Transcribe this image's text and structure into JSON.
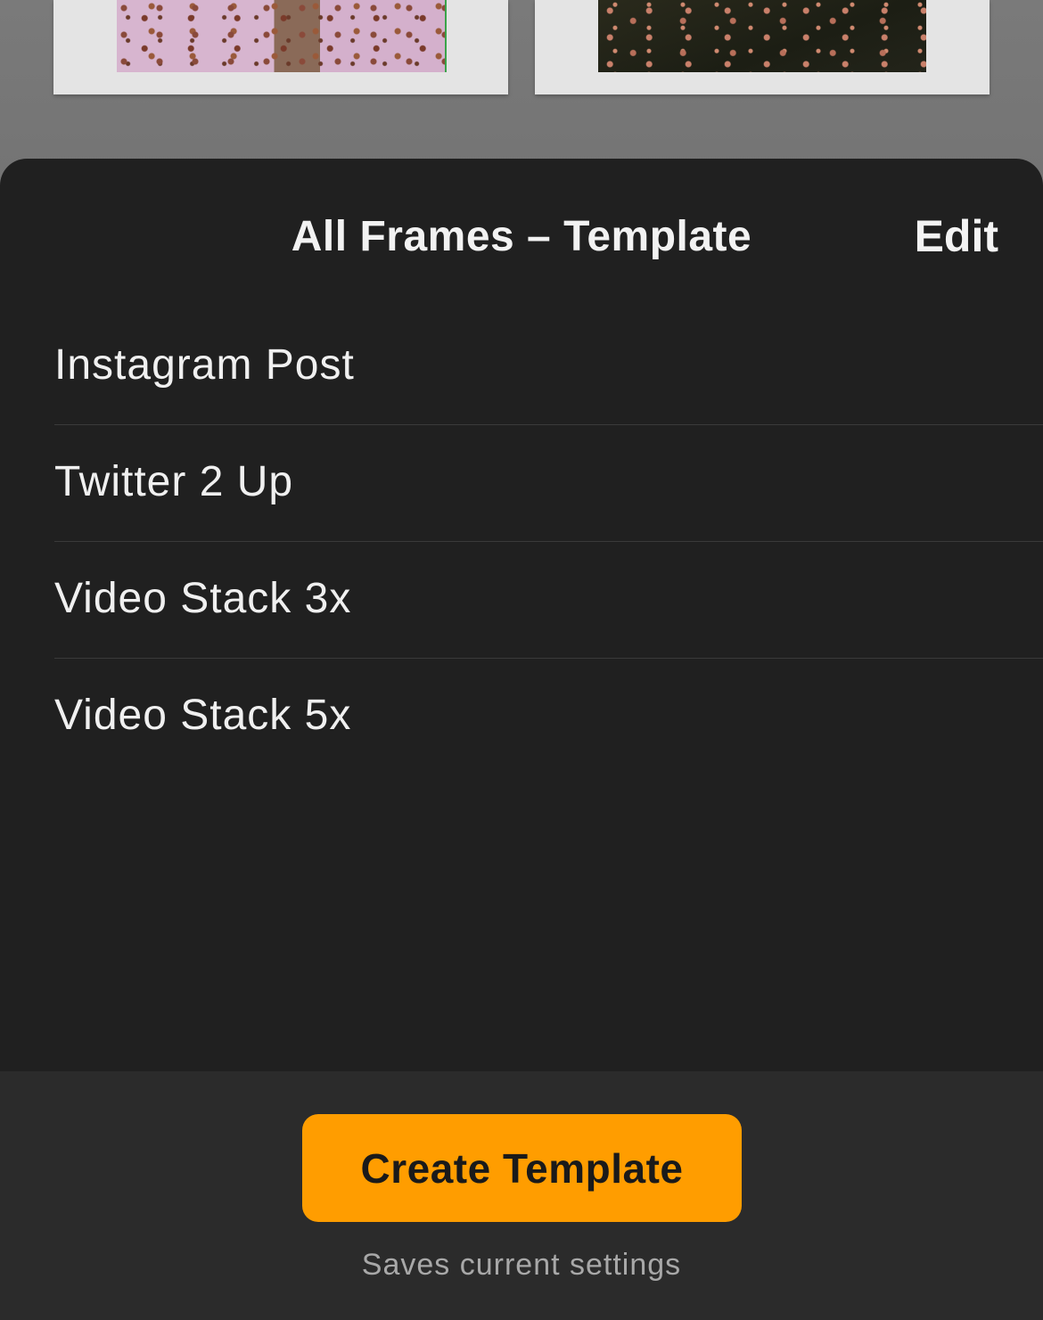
{
  "sheet": {
    "title": "All Frames – Template",
    "edit_label": "Edit"
  },
  "templates": [
    {
      "label": "Instagram Post"
    },
    {
      "label": "Twitter 2 Up"
    },
    {
      "label": "Video Stack 3x"
    },
    {
      "label": "Video Stack 5x"
    }
  ],
  "footer": {
    "create_label": "Create Template",
    "note": "Saves current settings"
  },
  "colors": {
    "accent": "#ff9d00",
    "sheet_background": "#202020",
    "footer_background": "#2b2b2b"
  }
}
